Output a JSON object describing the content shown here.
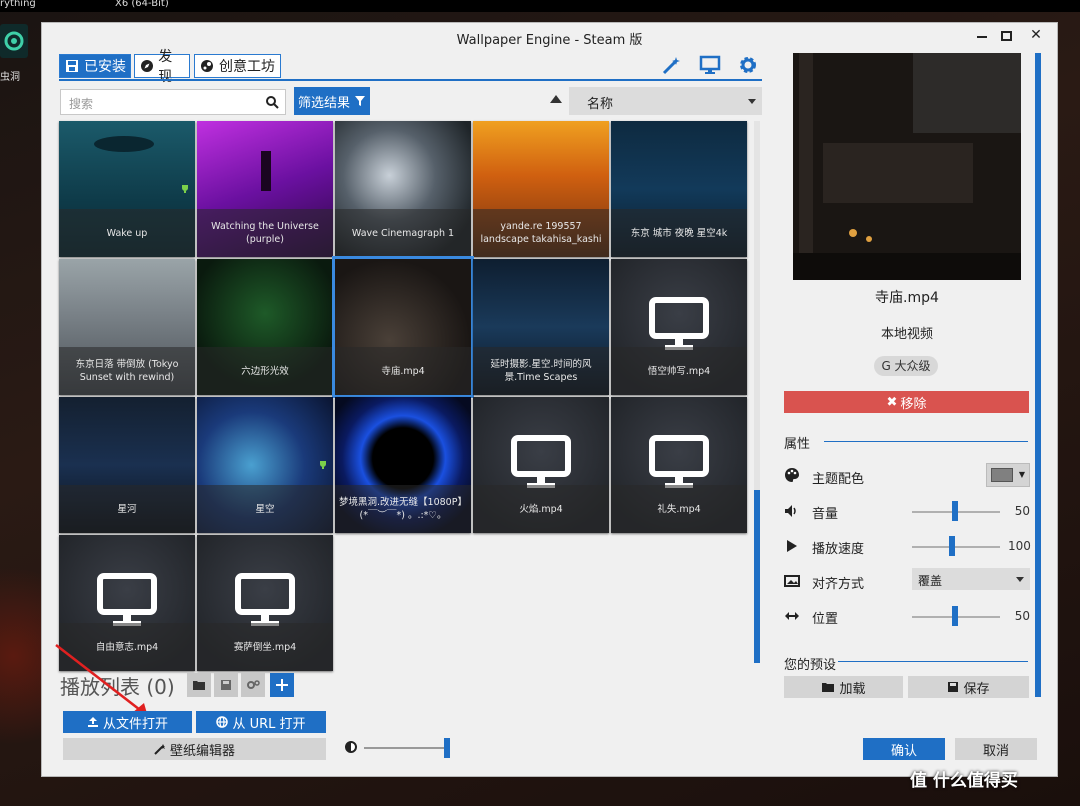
{
  "desktop": {
    "top_left_text": "rything",
    "top_mid_text": "X6 (64-Bit)",
    "icon_label": "虫洞"
  },
  "window": {
    "title": "Wallpaper Engine - Steam 版",
    "controls": {
      "close": "✕"
    }
  },
  "tabs": [
    {
      "label": "已安装",
      "icon": "save-icon"
    },
    {
      "label": "发现",
      "icon": "compass-icon"
    },
    {
      "label": "创意工坊",
      "icon": "steam-icon"
    }
  ],
  "toolbar_icons": [
    "wand-icon",
    "monitor-icon",
    "gear-icon"
  ],
  "search": {
    "placeholder": "搜索"
  },
  "filter_button": {
    "label": "筛选结果"
  },
  "sort": {
    "value": "名称"
  },
  "wallpapers": [
    {
      "title": "Wake up",
      "trophy": true
    },
    {
      "title": "Watching the Universe (purple)",
      "trophy": false
    },
    {
      "title": "Wave Cinemagraph 1",
      "trophy": false
    },
    {
      "title": "yande.re 199557 landscape takahisa_kashi",
      "trophy": false
    },
    {
      "title": "东京 城市 夜晚 星空4k",
      "trophy": false
    },
    {
      "title": "东京日落 带倒放 (Tokyo Sunset with rewind)",
      "trophy": false
    },
    {
      "title": "六边形光效",
      "trophy": false
    },
    {
      "title": "寺庙.mp4",
      "trophy": false,
      "selected": true
    },
    {
      "title": "延时摄影.星空.时间的风景.Time Scapes",
      "trophy": false
    },
    {
      "title": "悟空帅写.mp4",
      "trophy": false,
      "placeholder_icon": true
    },
    {
      "title": "星河",
      "trophy": false
    },
    {
      "title": "星空",
      "trophy": true
    },
    {
      "title": "梦境黑洞.改进无缝【1080P】(*￣︶￣*) 。.:*♡。",
      "trophy": false
    },
    {
      "title": "火焰.mp4",
      "trophy": false,
      "placeholder_icon": true
    },
    {
      "title": "礼失.mp4",
      "trophy": false,
      "placeholder_icon": true
    },
    {
      "title": "自由意志.mp4",
      "trophy": false,
      "placeholder_icon": true
    },
    {
      "title": "赛萨倒坐.mp4",
      "trophy": false,
      "placeholder_icon": true
    }
  ],
  "playlist": {
    "label": "播放列表",
    "count": "(0)"
  },
  "buttons": {
    "open_file": "从文件打开",
    "open_url": "从 URL 打开",
    "editor": "壁纸编辑器",
    "ok": "确认",
    "cancel": "取消"
  },
  "zoom": {
    "level": 1.0
  },
  "details": {
    "name": "寺庙.mp4",
    "type": "本地视频",
    "rating": "G 大众级",
    "remove": "移除"
  },
  "properties": {
    "section": "属性",
    "theme_color_label": "主题配色",
    "theme_color": "#808080",
    "volume_label": "音量",
    "volume": "50",
    "speed_label": "播放速度",
    "speed": "100",
    "align_label": "对齐方式",
    "align_value": "覆盖",
    "position_label": "位置",
    "position": "50"
  },
  "presets": {
    "section": "您的预设",
    "load": "加载",
    "save": "保存"
  },
  "watermark": "值 什么值得买",
  "colors": {
    "accent": "#1f6fc5",
    "danger": "#d9534f"
  }
}
